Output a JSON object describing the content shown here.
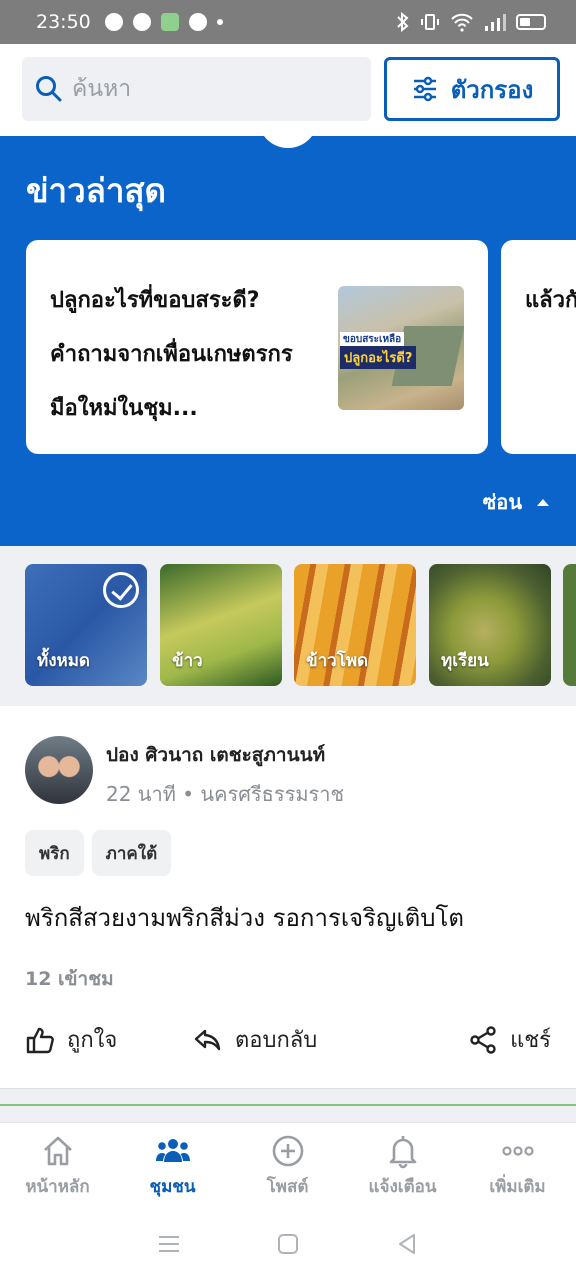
{
  "status_bar": {
    "time": "23:50",
    "left_icons": [
      "line-icon",
      "discord-icon",
      "app-icon",
      "messenger-icon",
      "dot-icon"
    ],
    "right_icons": [
      "bluetooth-icon",
      "vibrate-icon",
      "wifi-icon",
      "signal-icon",
      "battery-icon"
    ]
  },
  "search": {
    "placeholder": "ค้นหา",
    "filter_label": "ตัวกรอง"
  },
  "news": {
    "title": "ข่าวล่าสุด",
    "cards": [
      {
        "text": "ปลูกอะไรที่ขอบสระดี? คำถามจากเพื่อนเกษตรกรมือใหม่ในชุม...",
        "thumb_label_top": "ขอบสระเหลือ",
        "thumb_label_bottom": "ปลูกอะไรดี?"
      },
      {
        "text": "แล้วกัน . ."
      }
    ],
    "hide_label": "ซ่อน"
  },
  "categories": [
    {
      "name": "ทั้งหมด",
      "selected": true
    },
    {
      "name": "ข้าว",
      "selected": false
    },
    {
      "name": "ข้าวโพด",
      "selected": false
    },
    {
      "name": "ทุเรียน",
      "selected": false
    }
  ],
  "post": {
    "author": "ปอง ศิวนาถ เตชะสูภานนท์",
    "meta": "22 นาที • นครศรีธรรมราช",
    "tags": [
      "พริก",
      "ภาคใต้"
    ],
    "text": "พริกสีสวยงามพริกสีม่วง รอการเจริญเติบโต",
    "views": "12 เข้าชม",
    "actions": {
      "like": "ถูกใจ",
      "reply": "ตอบกลับ",
      "share": "แชร์"
    }
  },
  "bottom_nav": [
    {
      "label": "หน้าหลัก",
      "icon": "home-icon",
      "active": false
    },
    {
      "label": "ชุมชน",
      "icon": "community-icon",
      "active": true
    },
    {
      "label": "โพสต์",
      "icon": "add-post-icon",
      "active": false
    },
    {
      "label": "แจ้งเตือน",
      "icon": "bell-icon",
      "active": false
    },
    {
      "label": "เพิ่มเติม",
      "icon": "more-icon",
      "active": false
    }
  ],
  "colors": {
    "primary": "#0a5eb7",
    "news_background": "#0a64c9",
    "muted": "#8a8e94"
  }
}
